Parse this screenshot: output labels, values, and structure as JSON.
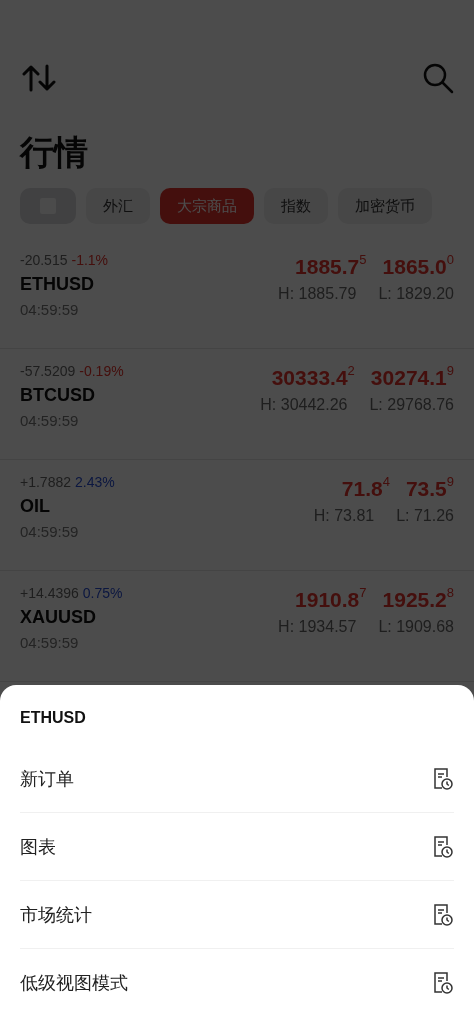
{
  "header": {
    "title": "行情"
  },
  "tabs": [
    {
      "kind": "icon",
      "selected": false
    },
    {
      "kind": "text",
      "label": "外汇",
      "selected": false
    },
    {
      "kind": "text",
      "label": "大宗商品",
      "selected": true
    },
    {
      "kind": "text",
      "label": "指数",
      "selected": false
    },
    {
      "kind": "text",
      "label": "加密货币",
      "selected": false
    }
  ],
  "quotes": [
    {
      "change": "-20.515",
      "percent": "-1.1%",
      "kind": "loss",
      "symbol": "ETHUSD",
      "time": "04:59:59",
      "bid": {
        "main": "1885.7",
        "sup": "5"
      },
      "ask": {
        "main": "1865.0",
        "sup": "0"
      },
      "high": "H: 1885.79",
      "low": "L: 1829.20"
    },
    {
      "change": "-57.5209",
      "percent": "-0.19%",
      "kind": "loss",
      "symbol": "BTCUSD",
      "time": "04:59:59",
      "bid": {
        "main": "30333.4",
        "sup": "2"
      },
      "ask": {
        "main": "30274.1",
        "sup": "9"
      },
      "high": "H: 30442.26",
      "low": "L: 29768.76"
    },
    {
      "change": "+1.7882",
      "percent": "2.43%",
      "kind": "gain",
      "symbol": "OIL",
      "time": "04:59:59",
      "bid": {
        "main": "71.8",
        "sup": "4"
      },
      "ask": {
        "main": "73.5",
        "sup": "9"
      },
      "high": "H: 73.81",
      "low": "L: 71.26"
    },
    {
      "change": "+14.4396",
      "percent": "0.75%",
      "kind": "gain",
      "symbol": "XAUUSD",
      "time": "04:59:59",
      "bid": {
        "main": "1910.8",
        "sup": "7"
      },
      "ask": {
        "main": "1925.2",
        "sup": "8"
      },
      "high": "H: 1934.57",
      "low": "L: 1909.68"
    }
  ],
  "sheet": {
    "title": "ETHUSD",
    "items": [
      "新订单",
      "图表",
      "市场统计",
      "低级视图模式"
    ]
  }
}
